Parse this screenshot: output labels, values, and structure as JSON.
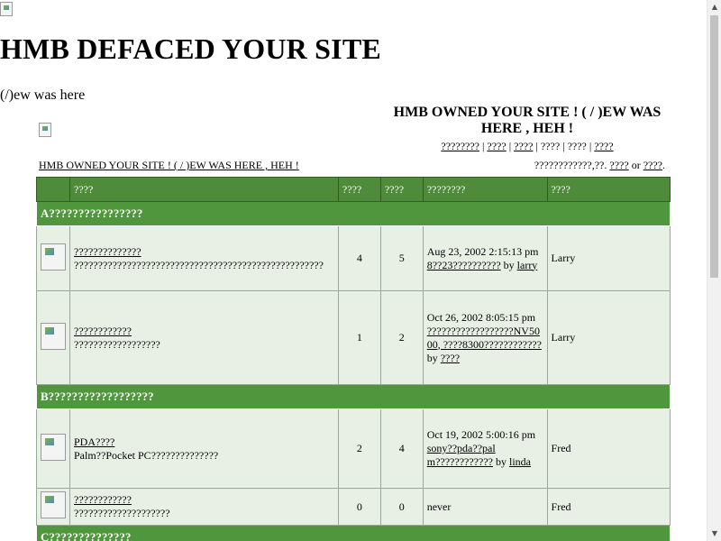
{
  "heading": "HMB DEFACED YOUR SITE",
  "subheading": "(/)ew was here",
  "banner": {
    "title": "HMB OWNED YOUR SITE ! ( / )EW WAS HERE , HEH !",
    "nav": [
      "????????",
      "????",
      "????",
      "????",
      "????",
      "????"
    ]
  },
  "breadcrumb": "HMB OWNED YOUR SITE ! ( / )EW WAS HERE , HEH !",
  "login": {
    "prefix": "????????????,??. ",
    "link1": "????",
    "or": " or ",
    "link2": "????",
    "suffix": "."
  },
  "table": {
    "headers": [
      "",
      "????",
      "????",
      "????",
      "????????",
      "????"
    ],
    "categories": [
      {
        "name": "A????????????????",
        "forums": [
          {
            "title": "??????????????",
            "description": "????????????????????????????????????????????????????",
            "topics": "4",
            "posts": "5",
            "last_date": "Aug 23, 2002 2:15:13 pm",
            "last_link": "8??23??????????",
            "last_by": " by ",
            "last_user": "larry",
            "moderator": "Larry"
          },
          {
            "title": "????????????",
            "description": "??????????????????",
            "topics": "1",
            "posts": "2",
            "last_date": "Oct 26, 2002 8:05:15 pm",
            "last_link": "??????????????????NV5000, ????8300????????????",
            "last_by": " by ",
            "last_user": "????",
            "moderator": "Larry"
          }
        ]
      },
      {
        "name": "B??????????????????",
        "forums": [
          {
            "title": "PDA????",
            "description": "Palm??Pocket PC??????????????",
            "topics": "2",
            "posts": "4",
            "last_date": "Oct 19, 2002 5:00:16 pm",
            "last_link": "sony??pda??palm????????????",
            "last_by": " by ",
            "last_user": "linda",
            "moderator": "Fred"
          },
          {
            "title": "????????????",
            "description": "????????????????????",
            "topics": "0",
            "posts": "0",
            "last_date": "never",
            "last_link": "",
            "last_by": "",
            "last_user": "",
            "moderator": "Fred"
          }
        ]
      },
      {
        "name": "C??????????????",
        "forums": []
      }
    ]
  }
}
